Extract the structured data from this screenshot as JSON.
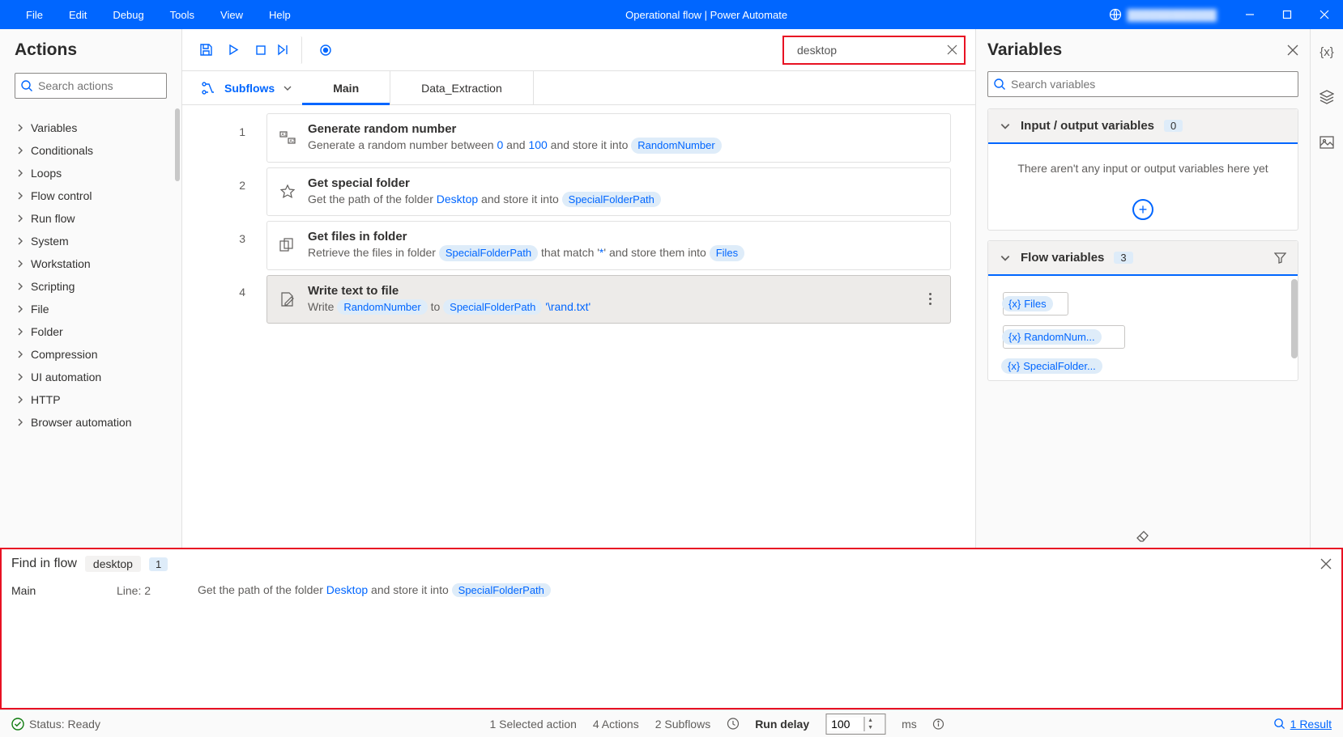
{
  "title": "Operational flow | Power Automate",
  "menu": [
    "File",
    "Edit",
    "Debug",
    "Tools",
    "View",
    "Help"
  ],
  "actions_panel": {
    "title": "Actions",
    "search_placeholder": "Search actions",
    "categories": [
      "Variables",
      "Conditionals",
      "Loops",
      "Flow control",
      "Run flow",
      "System",
      "Workstation",
      "Scripting",
      "File",
      "Folder",
      "Compression",
      "UI automation",
      "HTTP",
      "Browser automation"
    ]
  },
  "flow_search": {
    "value": "desktop"
  },
  "subflows_label": "Subflows",
  "tabs": [
    "Main",
    "Data_Extraction"
  ],
  "lines": [
    "1",
    "2",
    "3",
    "4"
  ],
  "steps": [
    {
      "title": "Generate random number",
      "desc_pre": "Generate a random number between ",
      "v1": "0",
      "mid1": " and ",
      "v2": "100",
      "mid2": " and store it into ",
      "pill": "RandomNumber"
    },
    {
      "title": "Get special folder",
      "desc_pre": "Get the path of the folder ",
      "v1": "Desktop",
      "mid1": " and store it into ",
      "pill": "SpecialFolderPath"
    },
    {
      "title": "Get files in folder",
      "desc_pre": "Retrieve the files in folder ",
      "pill1": "SpecialFolderPath",
      "mid1": " that match '",
      "v1": "*",
      "mid2": "' and store them into ",
      "pill2": "Files"
    },
    {
      "title": "Write text to file",
      "desc_pre": "Write ",
      "pill1": "RandomNumber",
      "mid1": " to ",
      "pill2": "SpecialFolderPath",
      "suffix": " '\\rand.txt'"
    }
  ],
  "variables_panel": {
    "title": "Variables",
    "search_placeholder": "Search variables",
    "io_title": "Input / output variables",
    "io_count": "0",
    "io_empty": "There aren't any input or output variables here yet",
    "flow_title": "Flow variables",
    "flow_count": "3",
    "flow_vars": [
      "Files",
      "RandomNum...",
      "SpecialFolder..."
    ]
  },
  "find": {
    "title": "Find in flow",
    "term": "desktop",
    "count": "1",
    "row": {
      "subflow": "Main",
      "line": "Line: 2",
      "desc_pre": "Get the path of the folder ",
      "v1": "Desktop",
      "mid": " and store it into ",
      "pill": "SpecialFolderPath"
    }
  },
  "status": {
    "text": "Status: Ready",
    "selected": "1 Selected action",
    "actions": "4 Actions",
    "subflows": "2 Subflows",
    "run_delay": "Run delay",
    "delay_value": "100",
    "ms": "ms",
    "result": "1 Result"
  }
}
